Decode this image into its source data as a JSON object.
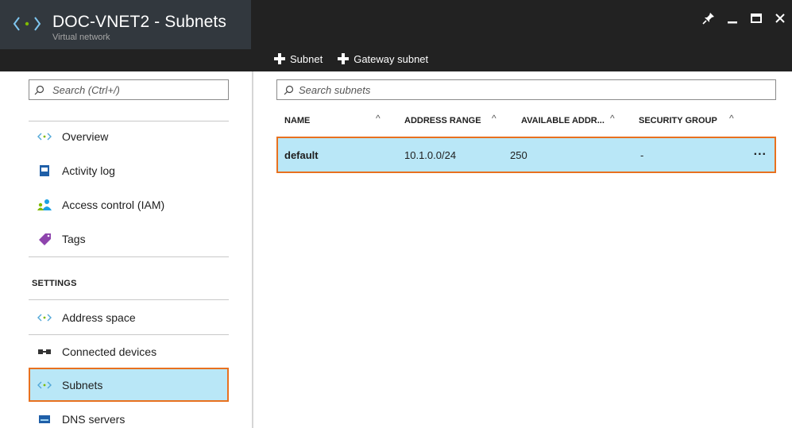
{
  "header": {
    "title": "DOC-VNET2 - Subnets",
    "subtitle": "Virtual network",
    "icons": [
      "vnet-icon",
      "pin-icon",
      "minimize-icon",
      "maximize-icon",
      "close-icon"
    ]
  },
  "commands": {
    "add_subnet": "Subnet",
    "add_gateway_subnet": "Gateway subnet"
  },
  "sidebar": {
    "search_placeholder": "Search (Ctrl+/)",
    "items": [
      {
        "label": "Overview",
        "icon": "vnet-icon"
      },
      {
        "label": "Activity log",
        "icon": "activity-log-icon"
      },
      {
        "label": "Access control (IAM)",
        "icon": "users-icon"
      },
      {
        "label": "Tags",
        "icon": "tag-icon"
      }
    ],
    "settings_label": "SETTINGS",
    "settings_items": [
      {
        "label": "Address space",
        "icon": "vnet-icon"
      },
      {
        "label": "Connected devices",
        "icon": "devices-icon"
      },
      {
        "label": "Subnets",
        "icon": "vnet-icon",
        "selected": true
      },
      {
        "label": "DNS servers",
        "icon": "dns-icon"
      }
    ]
  },
  "subnets": {
    "search_placeholder": "Search subnets",
    "columns": [
      "NAME",
      "ADDRESS RANGE",
      "AVAILABLE ADDR...",
      "SECURITY GROUP"
    ],
    "rows": [
      {
        "name": "default",
        "address_range": "10.1.0.0/24",
        "available": "250",
        "security_group": "-"
      }
    ],
    "more_label": "..."
  },
  "colors": {
    "header_bg": "#222222",
    "selected_bg": "#b9e7f7",
    "selected_border": "#e8711f",
    "accent": "#1ba1e2"
  }
}
